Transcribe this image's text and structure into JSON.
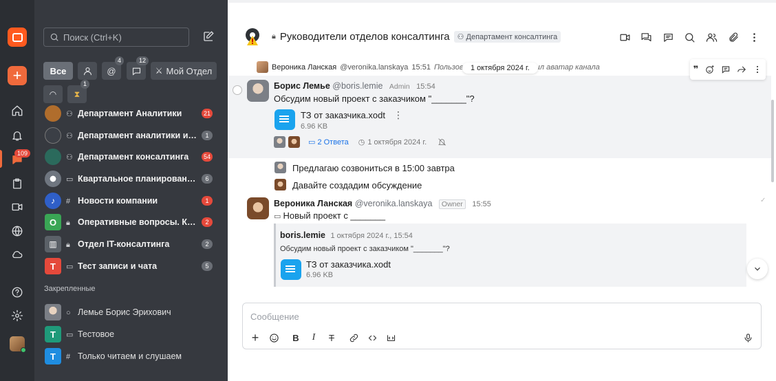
{
  "search": {
    "placeholder": "Поиск (Ctrl+K)"
  },
  "rail": {
    "unread_badge": "109"
  },
  "filters": {
    "all_label": "Все",
    "mentions_badge": "4",
    "threads_badge": "12",
    "my_dept_label": "Мой Отдел",
    "timer_badge": "1"
  },
  "chats": [
    {
      "title": "Департамент Аналитики",
      "badge": "21",
      "badge_red": true,
      "type_icon": "group-icon"
    },
    {
      "title": "Департамент аналитики и исследований",
      "badge": "1",
      "badge_red": false,
      "type_icon": "group-icon"
    },
    {
      "title": "Департамент консалтинга",
      "badge": "54",
      "badge_red": true,
      "type_icon": "group-icon"
    },
    {
      "title": "Квартальное планирование и отчётность",
      "badge": "6",
      "badge_red": false,
      "type_icon": "thread-icon"
    },
    {
      "title": "Новости компании",
      "badge": "1",
      "badge_red": true,
      "type_icon": "hash-icon"
    },
    {
      "title": "Оперативные вопросы. Команда",
      "badge": "2",
      "badge_red": true,
      "type_icon": "lock-icon",
      "letter": "O"
    },
    {
      "title": "Отдел IT-консалтинга",
      "badge": "2",
      "badge_red": false,
      "type_icon": "lock-icon"
    },
    {
      "title": "Тест записи и чата",
      "badge": "5",
      "badge_red": false,
      "type_icon": "video-icon",
      "letter": "T"
    }
  ],
  "pinned": {
    "heading": "Закрепленные",
    "items": [
      {
        "title": "Лемье Борис Эрихович"
      },
      {
        "title": "Тестовое",
        "letter": "T"
      },
      {
        "title": "Только читаем и слушаем",
        "letter": "T"
      }
    ]
  },
  "channel": {
    "title": "Руководители отделов консалтинга",
    "dept_tag": "Департамент консалтинга"
  },
  "date_pill": "1 октября 2024 г.",
  "system_message": {
    "name": "Вероника Ланская",
    "handle": "@veronika.lanskaya",
    "time": "15:51",
    "text_start": "Пользов",
    "text_end": "менил аватар канала"
  },
  "message1": {
    "name": "Борис Лемье",
    "handle": "@boris.lemie",
    "role": "Admin",
    "time": "15:54",
    "text": "Обсудим новый проект с заказчиком \"_______\"?",
    "file_name": "ТЗ от заказчика.xodt",
    "file_size": "6.96 KB",
    "replies": "2 Ответа",
    "reply_date": "1 октября 2024 г."
  },
  "thread_lines": [
    "Предлагаю созвониться в 15:00 завтра",
    "Давайте создадим обсуждение"
  ],
  "message2": {
    "name": "Вероника Ланская",
    "handle": "@veronika.lanskaya",
    "role": "Owner",
    "time": "15:55",
    "text": "Новый проект с _______",
    "quote_name": "boris.lemie",
    "quote_time": "1 октября 2024 г., 15:54",
    "quote_text": "Обсудим новый проект с заказчиком \"_______\"?",
    "file_name": "ТЗ от заказчика.xodt",
    "file_size": "6.96 KB"
  },
  "composer": {
    "placeholder": "Сообщение"
  },
  "colors": {
    "accent": "#f06a3c",
    "sidebar": "#36393f",
    "rail": "#2b2e33",
    "badge_red": "#e5493b",
    "link": "#1a73e8"
  }
}
